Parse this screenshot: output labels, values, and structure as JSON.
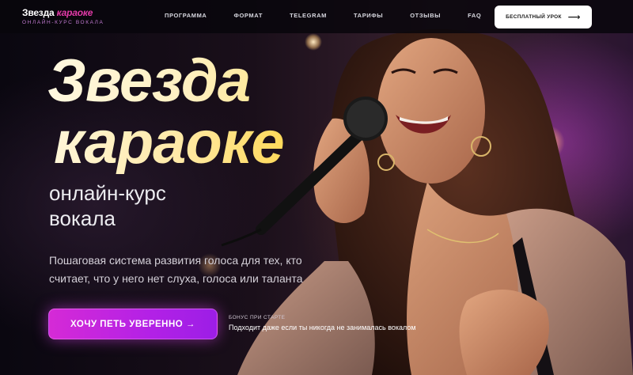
{
  "header": {
    "logo": {
      "word1": "Звезда",
      "word2": "караоке",
      "tagline": "ОНЛАЙН-КУРС ВОКАЛА"
    },
    "nav": [
      "ПРОГРАММА",
      "ФОРМАТ",
      "TELEGRAM",
      "ТАРИФЫ",
      "ОТЗЫВЫ",
      "FAQ"
    ],
    "cta_label": "БЕСПЛАТНЫЙ УРОК",
    "cta_arrow": "⟶"
  },
  "hero": {
    "title_line1": "Звезда",
    "title_line2": "караоке",
    "subtitle_line1": "онлайн-курс",
    "subtitle_line2": "вокала",
    "description": "Пошаговая система развития голоса для тех, кто считает, что у него нет слуха, голоса или таланта",
    "cta_label": "ХОЧУ ПЕТЬ УВЕРЕННО →",
    "bonus_label": "БОНУС ПРИ СТАРТЕ",
    "bonus_text": "Подходит даже если ты никогда не занималась вокалом"
  },
  "colors": {
    "accent": "#d52ad6",
    "title_gold": "#ffe58c",
    "logo_pink": "#e23aa8"
  }
}
